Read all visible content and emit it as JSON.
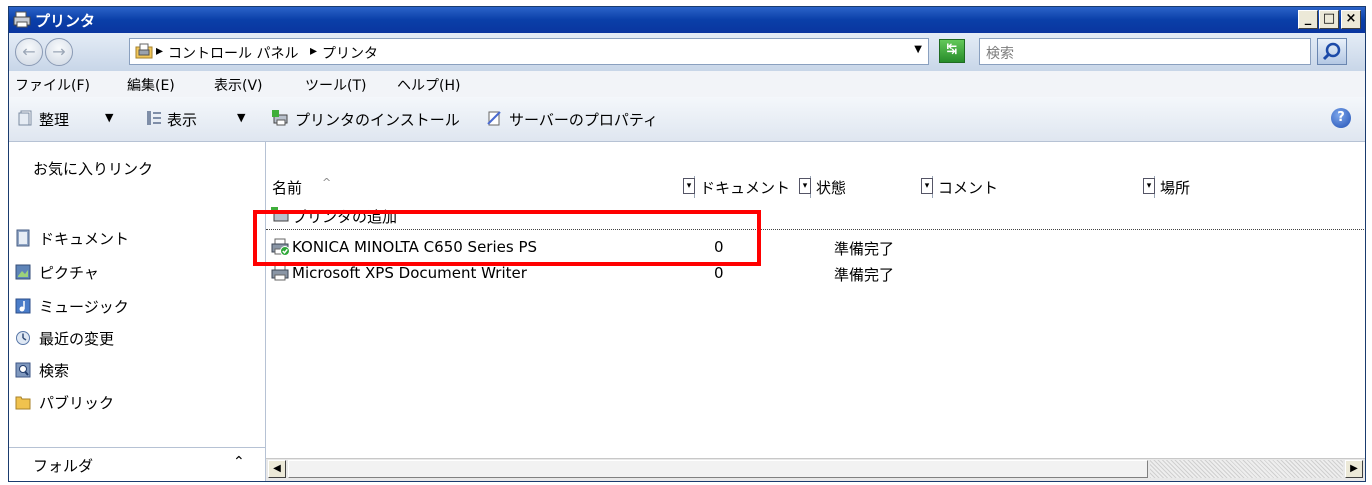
{
  "window": {
    "title": "プリンタ",
    "minimize_label": "_",
    "maximize_label": "□",
    "close_label": "×"
  },
  "address": {
    "crumbs": [
      "コントロール パネル",
      "プリンタ"
    ],
    "separator": "▸",
    "search_placeholder": "検索",
    "back_symbol": "←",
    "forward_symbol": "→"
  },
  "menu": {
    "items": [
      "ファイル(F)",
      "編集(E)",
      "表示(V)",
      "ツール(T)",
      "ヘルプ(H)"
    ]
  },
  "toolbar": {
    "organize": "整理",
    "view": "表示",
    "install_printer": "プリンタのインストール",
    "server_properties": "サーバーのプロパティ",
    "help": "?"
  },
  "nav": {
    "favorites_title": "お気に入りリンク",
    "items": [
      {
        "label": "ドキュメント",
        "icon": "documents-icon"
      },
      {
        "label": "ピクチャ",
        "icon": "pictures-icon"
      },
      {
        "label": "ミュージック",
        "icon": "music-icon"
      },
      {
        "label": "最近の変更",
        "icon": "recent-changes-icon"
      },
      {
        "label": "検索",
        "icon": "search-folder-icon"
      },
      {
        "label": "パブリック",
        "icon": "public-folder-icon"
      }
    ],
    "folders_label": "フォルダ"
  },
  "list": {
    "columns": [
      "名前",
      "ドキュメント",
      "状態",
      "コメント",
      "場所"
    ],
    "sort_indicator": "^",
    "add_printer": "プリンタの追加",
    "rows": [
      {
        "name": "KONICA MINOLTA C650 Series PS",
        "documents": "0",
        "status": "準備完了"
      },
      {
        "name": "Microsoft XPS Document Writer",
        "documents": "0",
        "status": "準備完了"
      }
    ]
  },
  "colors": {
    "titlebar": "#0a3fa8",
    "highlight": "#ff0000",
    "ready_check": "#2fa83a"
  }
}
